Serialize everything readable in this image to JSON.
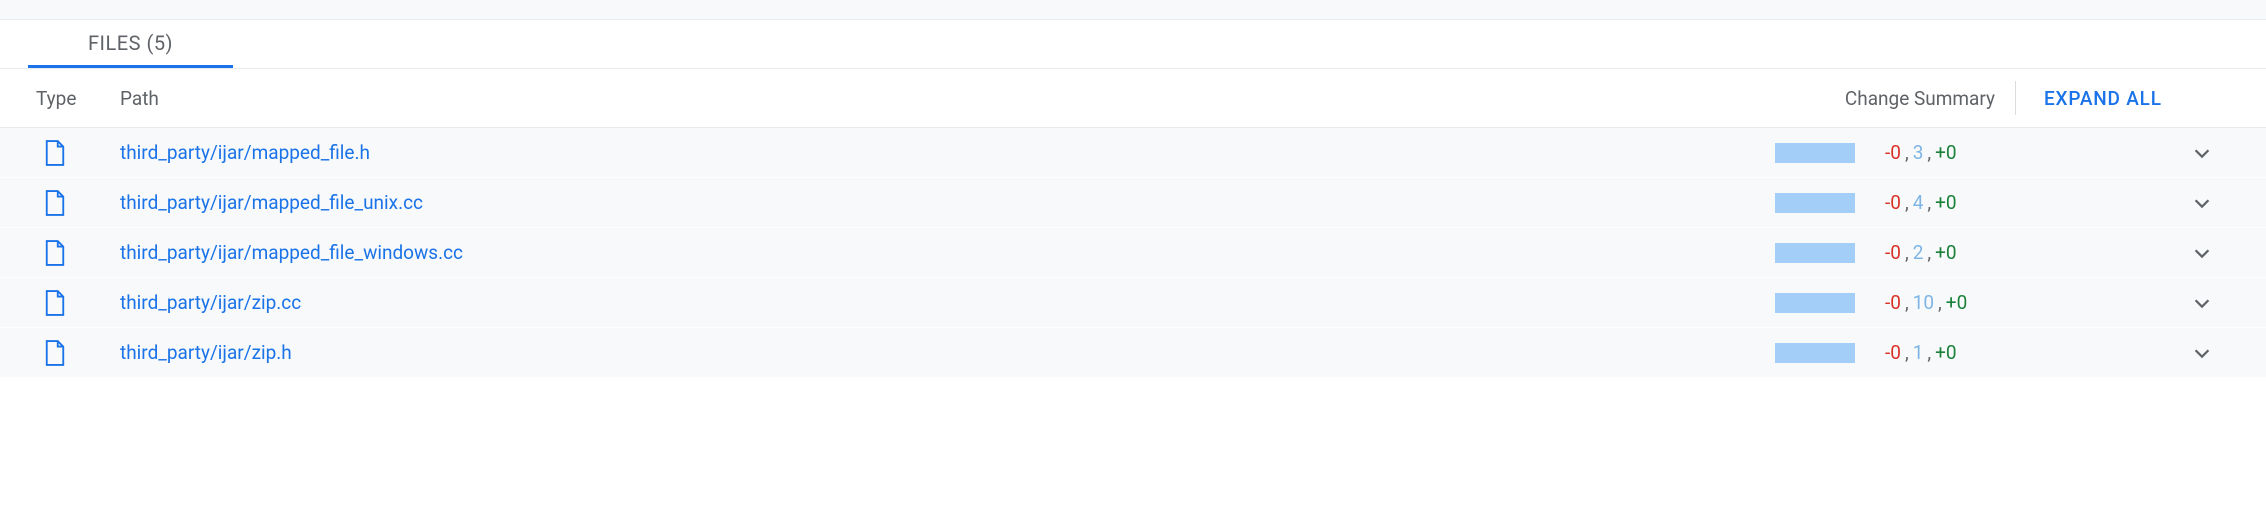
{
  "tab": {
    "label": "FILES (5)"
  },
  "headers": {
    "type": "Type",
    "path": "Path",
    "summary": "Change Summary",
    "expand": "EXPAND ALL"
  },
  "files": [
    {
      "path": "third_party/ijar/mapped_file.h",
      "del": "-0",
      "mod": "3",
      "add": "+0"
    },
    {
      "path": "third_party/ijar/mapped_file_unix.cc",
      "del": "-0",
      "mod": "4",
      "add": "+0"
    },
    {
      "path": "third_party/ijar/mapped_file_windows.cc",
      "del": "-0",
      "mod": "2",
      "add": "+0"
    },
    {
      "path": "third_party/ijar/zip.cc",
      "del": "-0",
      "mod": "10",
      "add": "+0"
    },
    {
      "path": "third_party/ijar/zip.h",
      "del": "-0",
      "mod": "1",
      "add": "+0"
    }
  ]
}
